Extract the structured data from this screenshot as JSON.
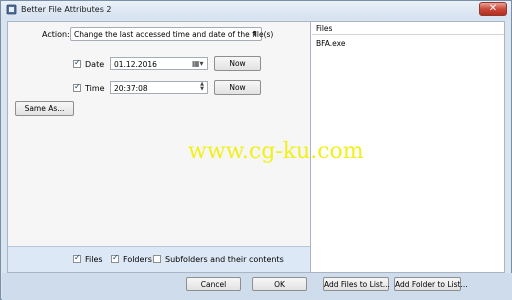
{
  "window": {
    "title": "Better File Attributes 2",
    "close_glyph": "✕",
    "app_icon": "app-icon"
  },
  "action": {
    "label": "Action:",
    "selected": "Change the last accessed time and date of the file(s)",
    "arrow_glyph": "⬍"
  },
  "date": {
    "checked": true,
    "label": "Date",
    "value": "01.12.2016",
    "now_label": "Now",
    "calendar_glyph": "▦▾"
  },
  "time": {
    "checked": true,
    "label": "Time",
    "value": "20:37:08",
    "now_label": "Now",
    "spin_up": "▲",
    "spin_down": "▼"
  },
  "same_as_label": "Same As...",
  "filters": {
    "files": {
      "checked": true,
      "label": "Files"
    },
    "folders": {
      "checked": true,
      "label": "Folders"
    },
    "subfolders": {
      "checked": false,
      "label": "Subfolders and their contents"
    }
  },
  "files_panel": {
    "header": "Files",
    "items": [
      "BFA.exe"
    ]
  },
  "watermark": "www.cg-ku.com",
  "footer": {
    "cancel_label": "Cancel",
    "ok_label": "OK",
    "add_files_label": "Add Files to List...",
    "add_folder_label": "Add Folder to List..."
  },
  "colors": {
    "title_bar": "#d6e2f0",
    "close_button": "#c9493a",
    "watermark": "#f1f01a",
    "footer": "#cfdceb"
  }
}
